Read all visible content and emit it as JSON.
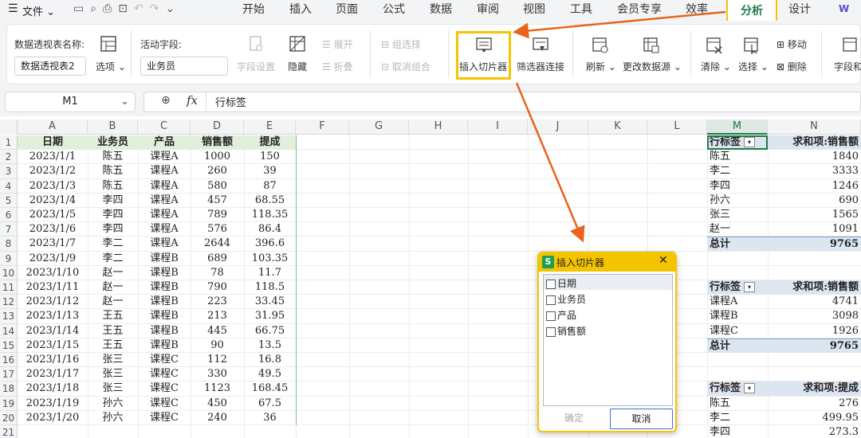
{
  "menubar": {
    "menu_icon": "hamburger-icon",
    "file_label": "文件",
    "tabs": [
      "开始",
      "插入",
      "页面",
      "公式",
      "数据",
      "审阅",
      "视图",
      "工具",
      "会员专享",
      "效率",
      "分析",
      "设计"
    ],
    "active_tab": "分析",
    "account_letter": "W"
  },
  "ribbon": {
    "pivot_name_label": "数据透视表名称:",
    "pivot_name_value": "数据透视表2",
    "options_label": "选项",
    "active_field_label": "活动字段:",
    "active_field_value": "业务员",
    "field_settings": "字段设置",
    "hide": "隐藏",
    "expand": "展开",
    "collapse": "折叠",
    "group_selection": "组选择",
    "ungroup": "取消组合",
    "insert_slicer": "插入切片器",
    "filter_connections": "筛选器连接",
    "refresh": "刷新",
    "change_source": "更改数据源",
    "clear": "清除",
    "select": "选择",
    "move": "移动",
    "delete": "删除",
    "field_list": "字段和"
  },
  "formula_bar": {
    "name_box": "M1",
    "fx": "fx",
    "content": "行标签"
  },
  "columns": [
    "A",
    "B",
    "C",
    "D",
    "E",
    "F",
    "G",
    "H",
    "I",
    "J",
    "K",
    "L",
    "M",
    "N"
  ],
  "selected_column": "M",
  "row_numbers": [
    "1",
    "2",
    "3",
    "4",
    "5",
    "6",
    "7",
    "8",
    "9",
    "10",
    "11",
    "12",
    "13",
    "14",
    "15",
    "16",
    "17",
    "18",
    "19",
    "20",
    "21"
  ],
  "table": {
    "headers": [
      "日期",
      "业务员",
      "产品",
      "销售额",
      "提成"
    ],
    "rows": [
      [
        "2023/1/1",
        "陈五",
        "课程A",
        "1000",
        "150"
      ],
      [
        "2023/1/2",
        "陈五",
        "课程A",
        "260",
        "39"
      ],
      [
        "2023/1/3",
        "陈五",
        "课程A",
        "580",
        "87"
      ],
      [
        "2023/1/4",
        "李四",
        "课程A",
        "457",
        "68.55"
      ],
      [
        "2023/1/5",
        "李四",
        "课程A",
        "789",
        "118.35"
      ],
      [
        "2023/1/6",
        "李四",
        "课程A",
        "576",
        "86.4"
      ],
      [
        "2023/1/7",
        "李二",
        "课程A",
        "2644",
        "396.6"
      ],
      [
        "2023/1/9",
        "李二",
        "课程B",
        "689",
        "103.35"
      ],
      [
        "2023/1/10",
        "赵一",
        "课程B",
        "78",
        "11.7"
      ],
      [
        "2023/1/11",
        "赵一",
        "课程B",
        "790",
        "118.5"
      ],
      [
        "2023/1/12",
        "赵一",
        "课程B",
        "223",
        "33.45"
      ],
      [
        "2023/1/13",
        "王五",
        "课程B",
        "213",
        "31.95"
      ],
      [
        "2023/1/14",
        "王五",
        "课程B",
        "445",
        "66.75"
      ],
      [
        "2023/1/15",
        "王五",
        "课程B",
        "90",
        "13.5"
      ],
      [
        "2023/1/16",
        "张三",
        "课程C",
        "112",
        "16.8"
      ],
      [
        "2023/1/17",
        "张三",
        "课程C",
        "330",
        "49.5"
      ],
      [
        "2023/1/18",
        "张三",
        "课程C",
        "1123",
        "168.45"
      ],
      [
        "2023/1/19",
        "孙六",
        "课程C",
        "450",
        "67.5"
      ],
      [
        "2023/1/20",
        "孙六",
        "课程C",
        "240",
        "36"
      ]
    ]
  },
  "pivot1": {
    "row_label": "行标签",
    "value_label": "求和项:销售额",
    "rows": [
      [
        "陈五",
        "1840"
      ],
      [
        "李二",
        "3333"
      ],
      [
        "李四",
        "1246"
      ],
      [
        "孙六",
        "690"
      ],
      [
        "张三",
        "1565"
      ],
      [
        "赵一",
        "1091"
      ]
    ],
    "total_label": "总计",
    "total_value": "9765"
  },
  "pivot2": {
    "row_label": "行标签",
    "value_label": "求和项:销售额",
    "rows": [
      [
        "课程A",
        "4741"
      ],
      [
        "课程B",
        "3098"
      ],
      [
        "课程C",
        "1926"
      ]
    ],
    "total_label": "总计",
    "total_value": "9765"
  },
  "pivot3": {
    "row_label": "行标签",
    "value_label": "求和项:提成",
    "rows": [
      [
        "陈五",
        "276"
      ],
      [
        "李二",
        "499.95"
      ],
      [
        "李四",
        "273.3"
      ]
    ]
  },
  "dialog": {
    "badge": "S",
    "title": "插入切片器",
    "fields": [
      "日期",
      "业务员",
      "产品",
      "销售额"
    ],
    "ok": "确定",
    "cancel": "取消"
  },
  "colors": {
    "highlight": "#f5c400",
    "arrow": "#e8641c",
    "accent": "#1f7a48",
    "table_header": "#e2efda",
    "pivot_header": "#dce6f1"
  }
}
